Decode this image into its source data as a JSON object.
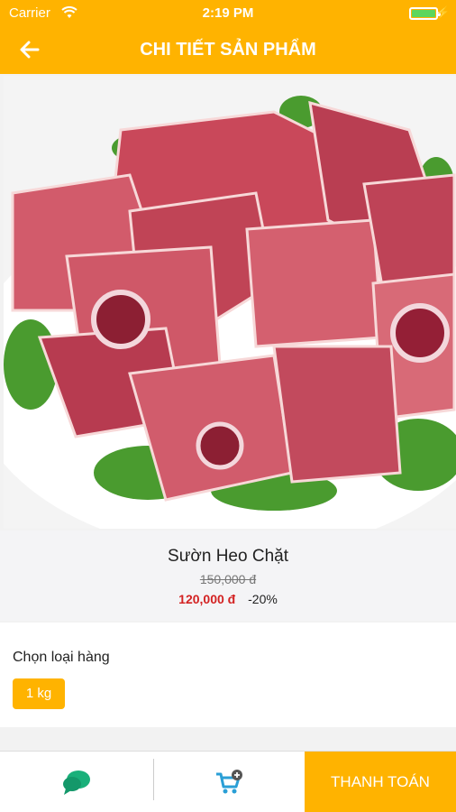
{
  "status_bar": {
    "carrier": "Carrier",
    "time": "2:19 PM",
    "battery_level": 1.0
  },
  "header": {
    "title": "CHI TIẾT SẢN PHẨM",
    "back_icon": "arrow-left-icon"
  },
  "product": {
    "name": "Sườn Heo Chặt",
    "original_price": "150,000 đ",
    "price": "120,000 đ",
    "discount": "-20%",
    "image_icon": "pork-ribs-photo"
  },
  "options": {
    "label": "Chọn loại hàng",
    "selected": "1 kg"
  },
  "bottom_bar": {
    "chat_icon": "chat-icon",
    "cart_icon": "add-to-cart-icon",
    "checkout_label": "THANH TOÁN"
  },
  "colors": {
    "accent": "#ffb300",
    "price_red": "#d32222",
    "chat_green": "#1ab07a",
    "cart_blue": "#2a9fd6"
  }
}
